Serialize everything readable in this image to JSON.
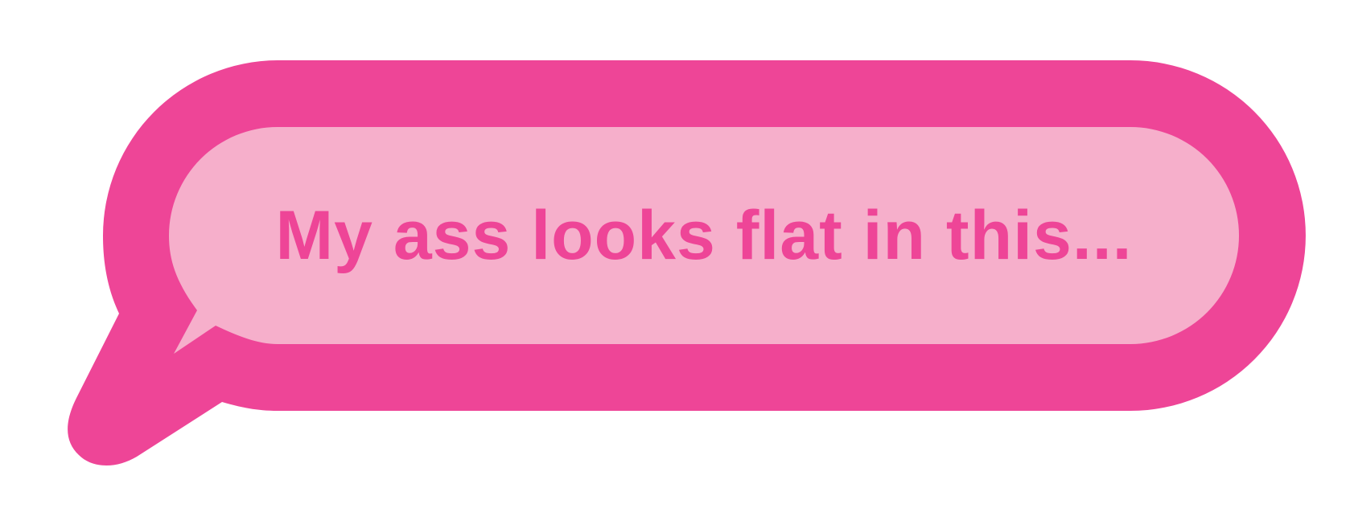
{
  "speech_bubble": {
    "text": "My ass looks flat in this...",
    "colors": {
      "outline": "#ee4597",
      "fill": "#f6afcb",
      "text": "#ee4597",
      "background": "#ffffff"
    }
  }
}
